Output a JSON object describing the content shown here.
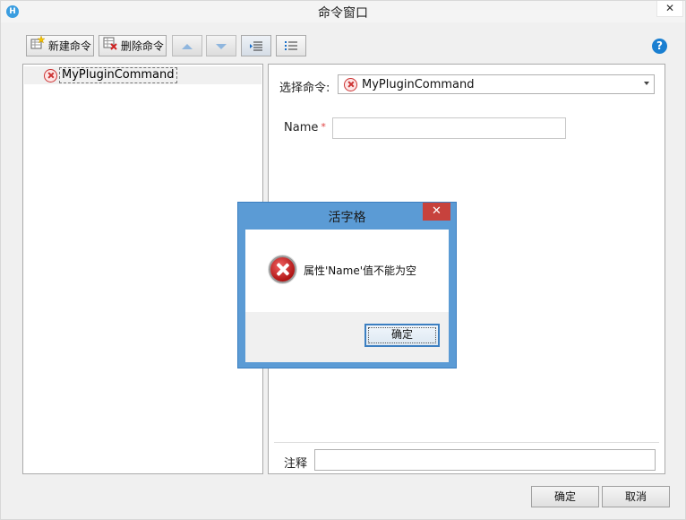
{
  "window": {
    "title": "命令窗口",
    "app_icon_letter": "H",
    "close_glyph": "✕"
  },
  "toolbar": {
    "new_label": "新建命令",
    "delete_label": "删除命令"
  },
  "help": {
    "glyph": "?"
  },
  "tree": {
    "items": [
      {
        "label": "MyPluginCommand",
        "status": "error"
      }
    ]
  },
  "form": {
    "select_label": "选择命令:",
    "select_value": "MyPluginCommand",
    "name_label": "Name",
    "required_mark": "*",
    "name_value": "",
    "note_label": "注释",
    "note_value": ""
  },
  "buttons": {
    "ok": "确定",
    "cancel": "取消"
  },
  "dialog": {
    "title": "活字格",
    "close_glyph": "✕",
    "message": "属性'Name'值不能为空",
    "ok": "确定"
  },
  "colors": {
    "dialog_frame": "#5b9bd5",
    "dialog_close": "#c7423d",
    "error_red": "#c33333",
    "help_blue": "#1a7fd1"
  }
}
